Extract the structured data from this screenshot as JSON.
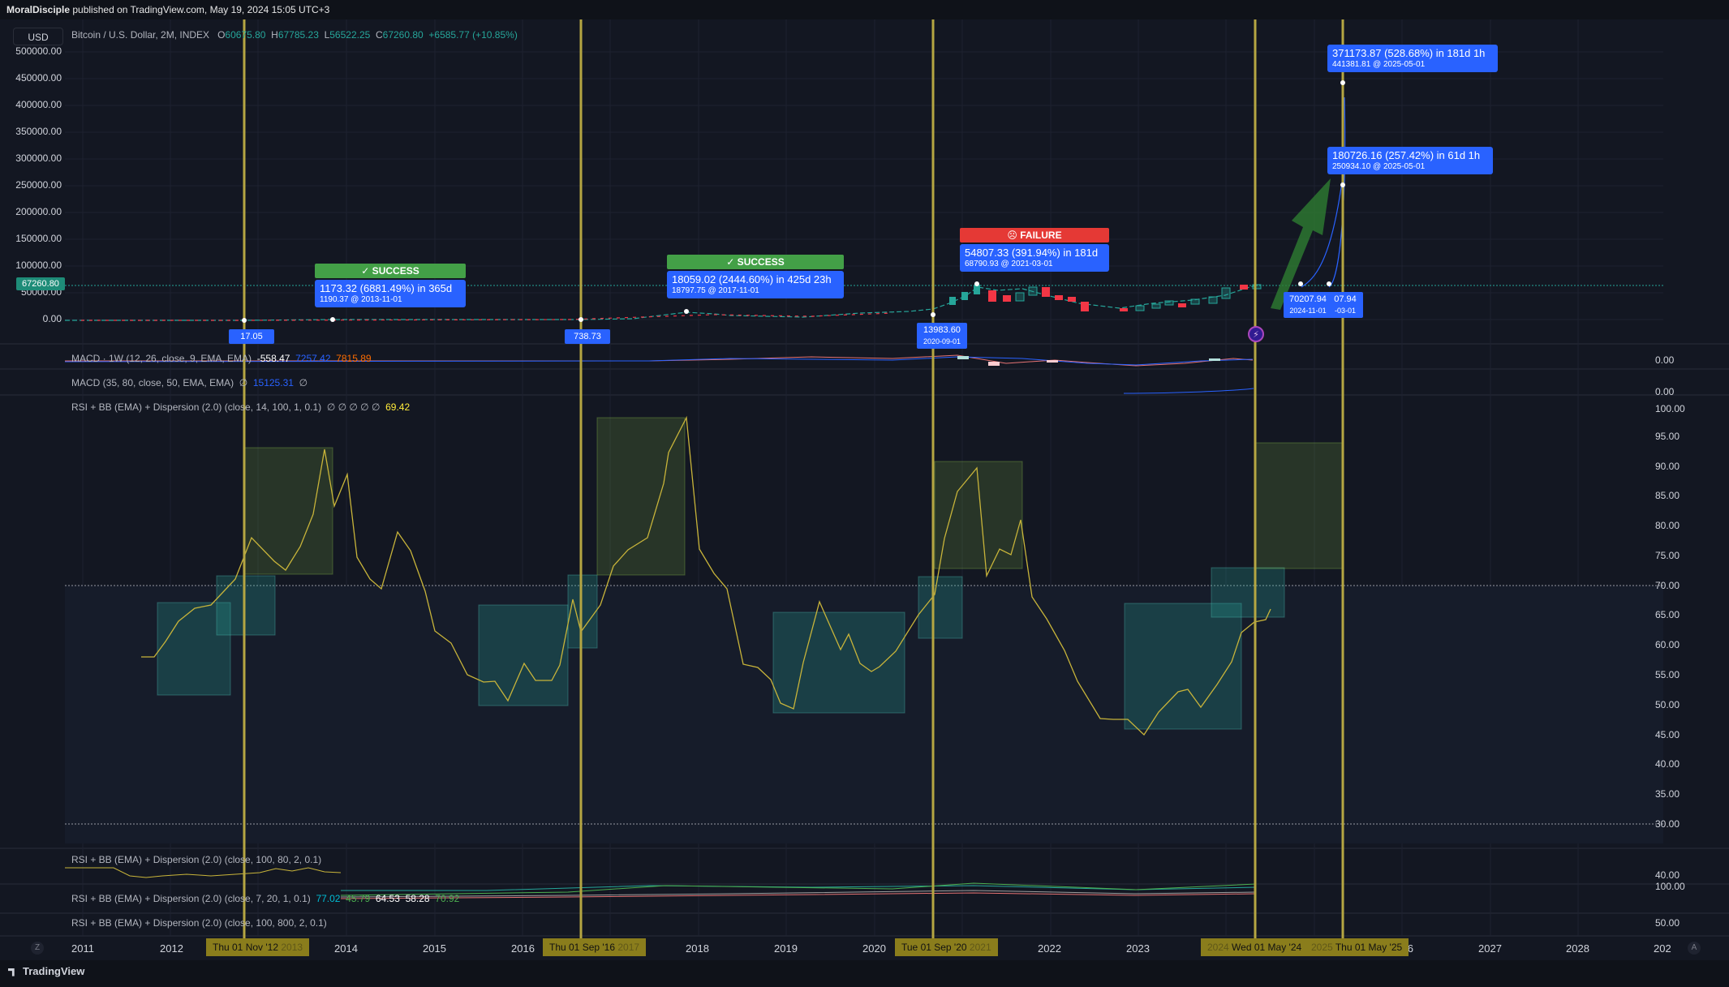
{
  "topbar": {
    "author": "MoralDisciple",
    "text": " published on TradingView.com, May 19, 2024 15:05 UTC+3"
  },
  "currency_button": "USD",
  "symbol": {
    "name": "Bitcoin / U.S. Dollar, 2M, INDEX",
    "o_label": "O",
    "o": "60675.80",
    "h_label": "H",
    "h": "67785.23",
    "l_label": "L",
    "l": "56522.25",
    "c_label": "C",
    "c": "67260.80",
    "change": "+6585.77 (+10.85%)"
  },
  "current_price_tag": "67260.80",
  "price_axis": [
    "500000.00",
    "450000.00",
    "400000.00",
    "350000.00",
    "300000.00",
    "250000.00",
    "200000.00",
    "150000.00",
    "100000.00",
    "50000.00",
    "0.00"
  ],
  "macd1": {
    "title": "MACD · 1W (12, 26, close, 9, EMA, EMA)",
    "v1": "-558.47",
    "v2": "7257.42",
    "v3": "7815.89",
    "axis": "0.00"
  },
  "macd2": {
    "title": "MACD (35, 80, close, 50, EMA, EMA)",
    "v1": "∅",
    "v2": "15125.31",
    "v3": "∅",
    "axis": "0.00"
  },
  "rsi_main": {
    "title": "RSI + BB (EMA) + Dispersion (2.0) (close, 14, 100, 1, 0.1)",
    "nulls": "∅ ∅ ∅ ∅ ∅",
    "value": "69.42",
    "axis": [
      "100.00",
      "95.00",
      "90.00",
      "85.00",
      "80.00",
      "75.00",
      "70.00",
      "65.00",
      "60.00",
      "55.00",
      "50.00",
      "45.00",
      "40.00",
      "35.00",
      "30.00"
    ]
  },
  "rsi_small1": {
    "title": "RSI + BB (EMA) + Dispersion (2.0) (close, 100, 80, 2, 0.1)",
    "axis": "40.00"
  },
  "rsi_small2": {
    "title": "RSI + BB (EMA) + Dispersion (2.0) (close, 7, 20, 1, 0.1)",
    "v1": "77.02",
    "v2": "45.79",
    "v3": "64.53",
    "v4": "58.28",
    "v5": "70.92",
    "axis": "100.00"
  },
  "rsi_small3": {
    "title": "RSI + BB (EMA) + Dispersion (2.0) (close, 100, 800, 2, 0.1)",
    "axis": "50.00"
  },
  "time_axis": [
    "2011",
    "2012",
    "2014",
    "2015",
    "2016",
    "2018",
    "2019",
    "2020",
    "2022",
    "2023",
    "2026",
    "2027",
    "2028",
    "202"
  ],
  "time_tags": [
    "Thu 01 Nov '12",
    "Thu 01 Sep '16",
    "Tue 01 Sep '20",
    "Wed 01 May '24",
    "Thu 01 May '25"
  ],
  "hidden_years": [
    "2013",
    "2017",
    "2021",
    "2024",
    "2025"
  ],
  "callouts": {
    "c1_main": "1173.32 (6881.49%) in 365d",
    "c1_sub": "1190.37 @ 2013-11-01",
    "c2_main": "18059.02 (2444.60%) in 425d 23h",
    "c2_sub": "18797.75 @ 2017-11-01",
    "c3_main": "54807.33 (391.94%) in 181d",
    "c3_sub": "68790.93 @ 2021-03-01",
    "c4_main": "371173.87 (528.68%) in 181d 1h",
    "c4_sub": "441381.81 @ 2025-05-01",
    "c5_main": "180726.16 (257.42%) in 61d 1h",
    "c5_sub": "250934.10 @ 2025-05-01"
  },
  "status": {
    "s1": "✓ SUCCESS",
    "s2": "✓ SUCCESS",
    "s3": "☹ FAILURE"
  },
  "low_tags": {
    "t1": "17.05",
    "t2": "738.73",
    "t3_main": "13983.60",
    "t3_sub": "2020-09-01",
    "t4_main": "70207.94",
    "t4_sub": "2024-11-01",
    "t5_main": "07.94",
    "t5_sub": "-03-01"
  },
  "footer": {
    "logo": "TradingView",
    "z": "Z",
    "a": "A"
  },
  "colors": {
    "bg": "#131722",
    "up": "#26a69a",
    "down": "#f23645",
    "vline": "#b5a642",
    "rsi": "#c8b43a"
  }
}
